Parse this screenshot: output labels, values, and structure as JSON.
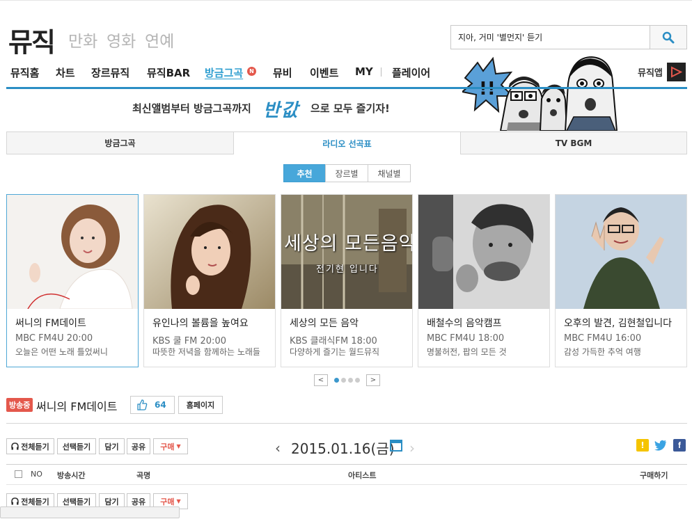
{
  "header": {
    "logo": "뮤직",
    "categories": [
      "만화",
      "영화",
      "연예"
    ],
    "search_value": "지아, 거미 '별먼지' 듣기"
  },
  "nav": {
    "items": [
      "뮤직홈",
      "차트",
      "장르뮤직",
      "뮤직BAR",
      "방금그곡",
      "뮤비",
      "이벤트",
      "MY",
      "플레이어"
    ],
    "active": "방금그곡",
    "new_badge": "N",
    "music_app": "뮤직앱"
  },
  "banner": {
    "text1": "최신앨범부터 방금그곡까지",
    "big": "반값",
    "text2": "으로 모두 즐기자!"
  },
  "main_tabs": [
    "방금그곡",
    "라디오 선곡표",
    "TV BGM"
  ],
  "main_tab_active": 1,
  "sub_tabs": [
    "추천",
    "장르별",
    "채널별"
  ],
  "sub_tab_active": 0,
  "cards": [
    {
      "title": "써니의 FM데이트",
      "station": "MBC FM4U 20:00",
      "desc": "오늘은 어떤 노래 틀었써니"
    },
    {
      "title": "유인나의 볼륨을 높여요",
      "station": "KBS 쿨 FM 20:00",
      "desc": "따뜻한 저녁을 함께하는 노래들"
    },
    {
      "title": "세상의 모든 음악",
      "station": "KBS 클래식FM 18:00",
      "desc": "다양하게 즐기는 월드뮤직",
      "image_text": "세상의 모든음악",
      "image_subtext": "전기현 입니다"
    },
    {
      "title": "배철수의 음악캠프",
      "station": "MBC FM4U 18:00",
      "desc": "명불허전, 팝의 모든 것"
    },
    {
      "title": "오후의 발견, 김현철입니다",
      "station": "MBC FM4U 16:00",
      "desc": "감성 가득한 추억 여행"
    }
  ],
  "pager": {
    "prev": "<",
    "next": ">",
    "dots": 4,
    "active_dot": 0
  },
  "program": {
    "badge": "방송중",
    "title": "써니의 FM데이트",
    "likes": "64",
    "homepage": "홈페이지"
  },
  "actions": {
    "listen_all": "전체듣기",
    "listen_selected": "선택듣기",
    "add": "담기",
    "share": "공유",
    "buy": "구매"
  },
  "date": "2015.01.16(금)",
  "table_headers": {
    "no": "NO",
    "time": "방송시간",
    "song": "곡명",
    "artist": "아티스트",
    "purchase": "구매하기"
  },
  "colors": {
    "accent": "#2b8ec4",
    "badge_red": "#e4584c",
    "subtab_active": "#47a7da"
  }
}
